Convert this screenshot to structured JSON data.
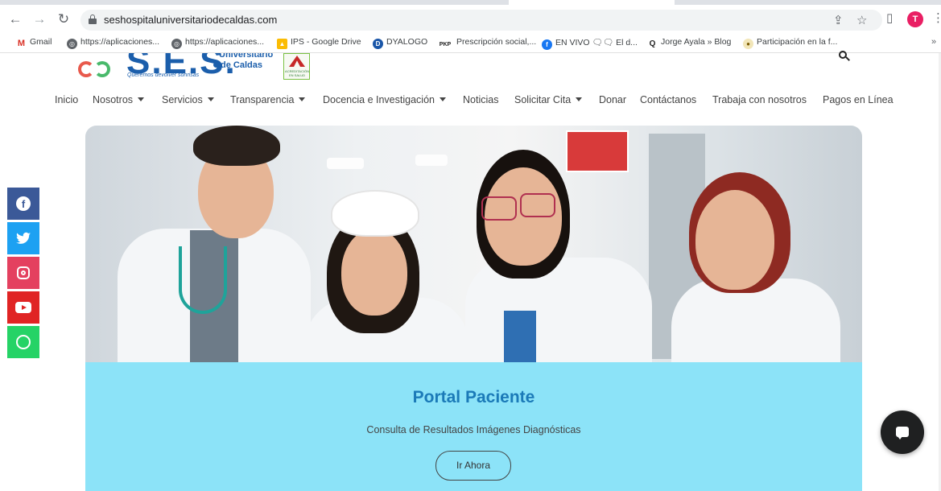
{
  "browser": {
    "url": "seshospitaluniversitariodecaldas.com",
    "profile_initial": "T",
    "icons": [
      "back-icon",
      "forward-icon",
      "reload-icon",
      "lock-icon",
      "share-icon",
      "star-icon",
      "sidepanel-icon",
      "menu-icon"
    ],
    "bookmarks": [
      {
        "label": "Gmail",
        "icon": "gmail-icon"
      },
      {
        "label": "https://aplicaciones...",
        "icon": "globe-icon"
      },
      {
        "label": "https://aplicaciones...",
        "icon": "globe-icon"
      },
      {
        "label": "IPS - Google Drive",
        "icon": "drive-icon"
      },
      {
        "label": "DYALOGO",
        "icon": "dyalogo-icon"
      },
      {
        "label": "Prescripción social,...",
        "icon": "pkp-icon"
      },
      {
        "label": "EN VIVO 🗨🗨 El d...",
        "icon": "facebook-icon"
      },
      {
        "label": "Jorge Ayala » Blog",
        "icon": "blog-icon"
      },
      {
        "label": "Participación en la f...",
        "icon": "seal-icon"
      }
    ],
    "bookmark_badges": {
      "pkp": "PKP",
      "dyalogo": "D"
    },
    "more_bookmarks": "»"
  },
  "site": {
    "logo": {
      "letters": "S.E.S.",
      "line1": "Universitario",
      "line2": "de Caldas",
      "tagline": "Queremos devolver sonrisas"
    },
    "accreditation": "ACREDITACIÓN EN SALUD",
    "nav": [
      {
        "label": "Inicio",
        "dropdown": false
      },
      {
        "label": "Nosotros",
        "dropdown": true
      },
      {
        "label": "Servicios",
        "dropdown": true
      },
      {
        "label": "Transparencia",
        "dropdown": true
      },
      {
        "label": "Docencia e Investigación",
        "dropdown": true
      },
      {
        "label": "Noticias",
        "dropdown": false
      },
      {
        "label": "Solicitar Cita",
        "dropdown": true
      },
      {
        "label": "Donar",
        "dropdown": false
      },
      {
        "label": "Contáctanos",
        "dropdown": false
      },
      {
        "label": "Trabaja con nosotros",
        "dropdown": false
      },
      {
        "label": "Pagos en Línea",
        "dropdown": false
      }
    ],
    "portal": {
      "title": "Portal Paciente",
      "subtitle": "Consulta de Resultados Imágenes Diagnósticas",
      "button": "Ir Ahora"
    },
    "social": [
      "facebook-icon",
      "twitter-icon",
      "instagram-icon",
      "youtube-icon",
      "whatsapp-icon"
    ],
    "colors": {
      "brand_blue": "#1b5eab",
      "portal_bg": "#8ce3f8",
      "portal_title": "#1b7ab8"
    }
  }
}
